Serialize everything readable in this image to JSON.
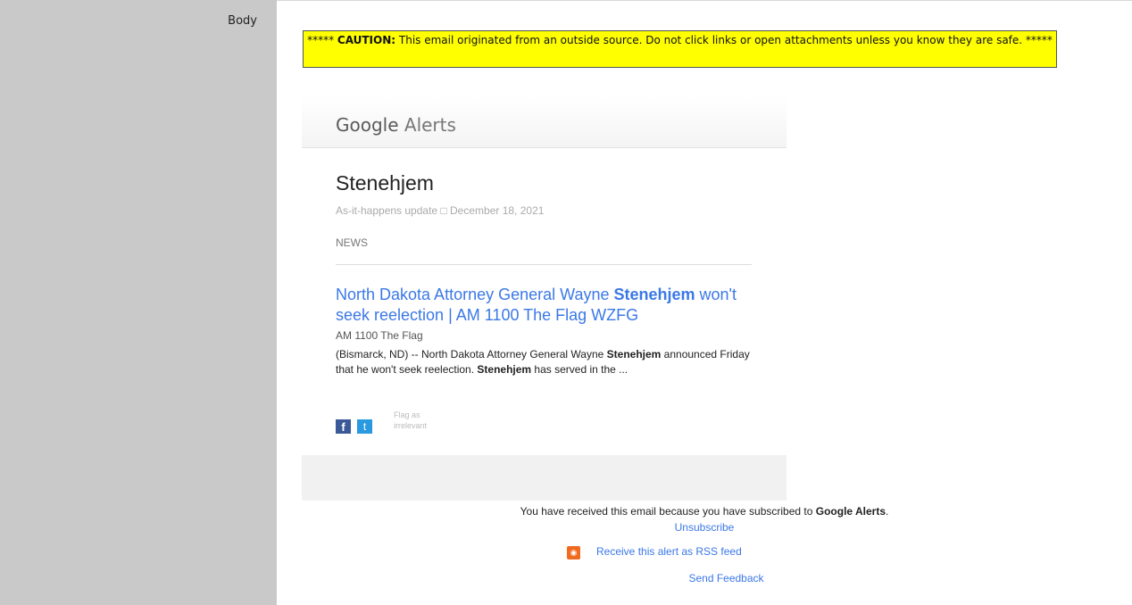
{
  "field": {
    "label": "Body"
  },
  "caution": {
    "prefix": "***** ",
    "label": "CAUTION:",
    "text": " This email originated from an outside source. Do not click links or open attachments unless you know they are safe. *****"
  },
  "alert": {
    "brand": "Google",
    "product": "Alerts",
    "query": "Stenehjem",
    "frequency": "As-it-happens update",
    "separator": "□",
    "date": "December 18, 2021",
    "section": "NEWS",
    "headline": {
      "part1": "North Dakota Attorney General Wayne ",
      "highlight": "Stenehjem",
      "part2": " won't seek reelection | AM 1100 The Flag WZFG"
    },
    "source": "AM 1100 The Flag",
    "snippet": {
      "part1": "(Bismarck, ND) -- North Dakota Attorney General Wayne ",
      "bold1": "Stenehjem",
      "part2": " announced Friday that he won't seek reelection. ",
      "bold2": "Stenehjem",
      "part3": " has served in the ..."
    },
    "share": {
      "facebook": "f",
      "twitter": "t"
    },
    "flag_label": "Flag as irrelevant"
  },
  "footer": {
    "received_prefix": "You have received this email because you have subscribed to ",
    "received_bold": "Google Alerts",
    "received_suffix": ".",
    "unsubscribe": "Unsubscribe",
    "rss": "Receive this alert as RSS feed",
    "feedback": "Send Feedback"
  },
  "colors": {
    "caution_bg": "#ffff00",
    "link": "#3b78e7",
    "sidebar": "#c9c9c9"
  }
}
